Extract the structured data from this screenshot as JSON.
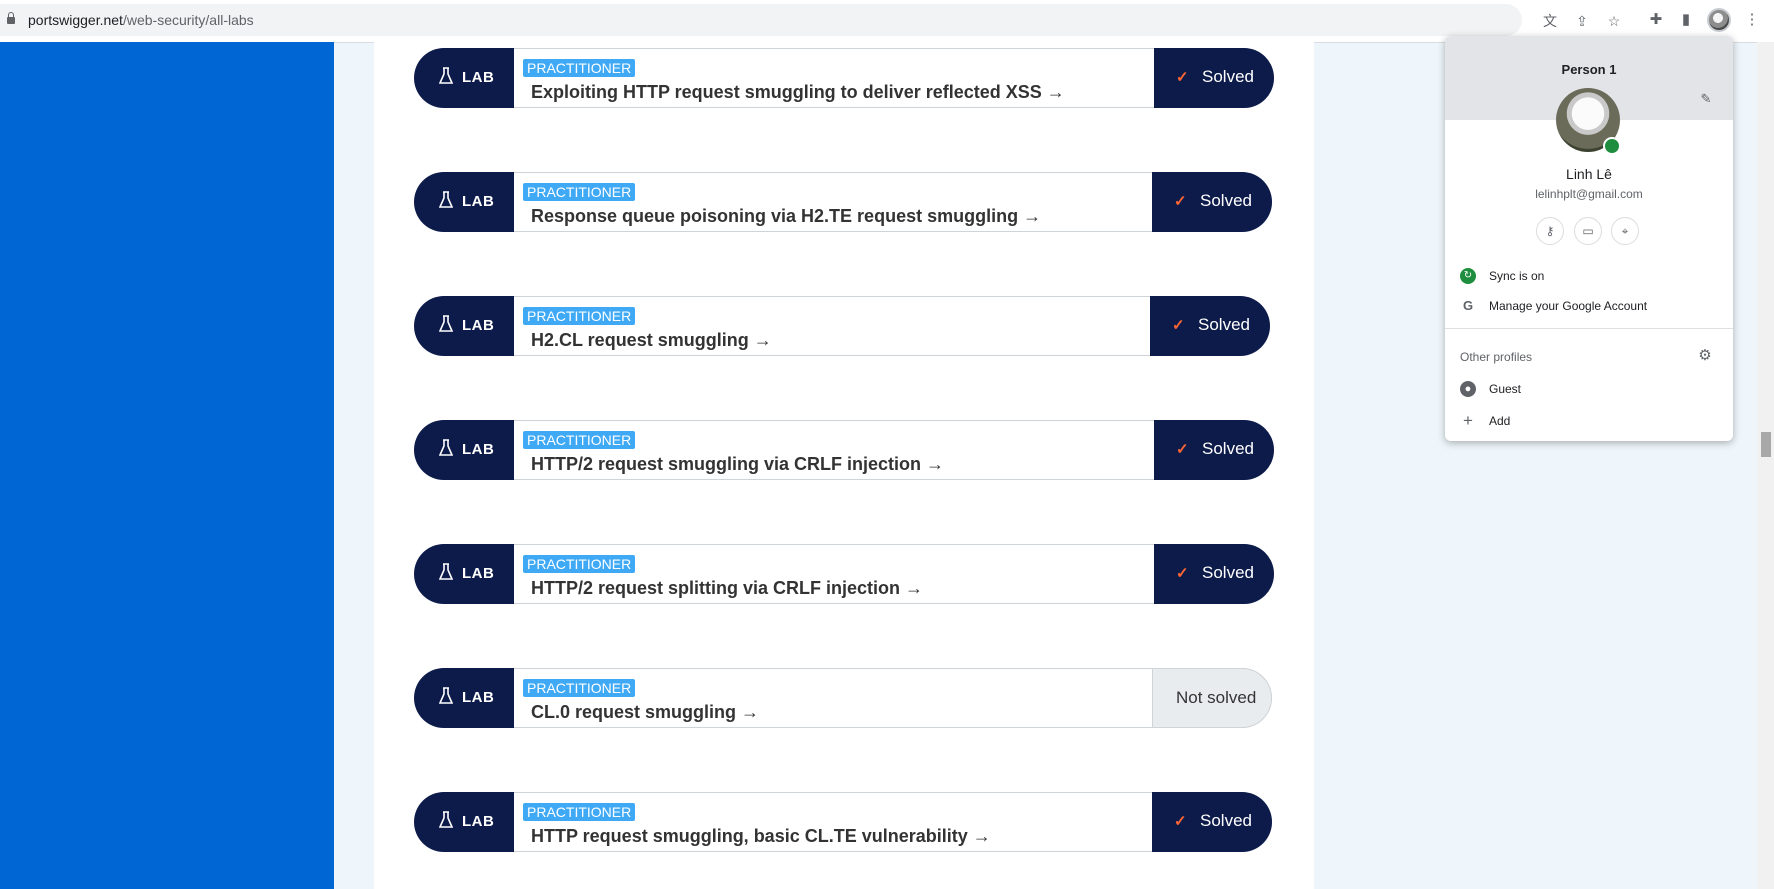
{
  "browser": {
    "url_host": "portswigger.net",
    "url_path": "/web-security/all-labs"
  },
  "labs": [
    {
      "badge": "LAB",
      "level": "PRACTITIONER",
      "title": "Exploiting HTTP request smuggling to deliver reflected XSS →",
      "status": "Solved",
      "solved": true
    },
    {
      "badge": "LAB",
      "level": "PRACTITIONER",
      "title": "Response queue poisoning via H2.TE request smuggling →",
      "status": "Solved",
      "solved": true
    },
    {
      "badge": "LAB",
      "level": "PRACTITIONER",
      "title": "H2.CL request smuggling →",
      "status": "Solved",
      "solved": true
    },
    {
      "badge": "LAB",
      "level": "PRACTITIONER",
      "title": "HTTP/2 request smuggling via CRLF injection →",
      "status": "Solved",
      "solved": true
    },
    {
      "badge": "LAB",
      "level": "PRACTITIONER",
      "title": "HTTP/2 request splitting via CRLF injection →",
      "status": "Solved",
      "solved": true
    },
    {
      "badge": "LAB",
      "level": "PRACTITIONER",
      "title": "CL.0 request smuggling →",
      "status": "Not solved",
      "solved": false
    },
    {
      "badge": "LAB",
      "level": "PRACTITIONER",
      "title": "HTTP request smuggling, basic CL.TE vulnerability →",
      "status": "Solved",
      "solved": true
    }
  ],
  "profile": {
    "header": "Person 1",
    "name": "Linh Lê",
    "email": "lelinhplt@gmail.com",
    "sync": "Sync is on",
    "manage": "Manage your Google Account",
    "other_profiles": "Other profiles",
    "guest": "Guest",
    "add": "Add"
  },
  "colors": {
    "navy": "#0d1b4b",
    "practitioner": "#3fa9f5",
    "check": "#ff6633",
    "side_blue": "#0066d4"
  }
}
